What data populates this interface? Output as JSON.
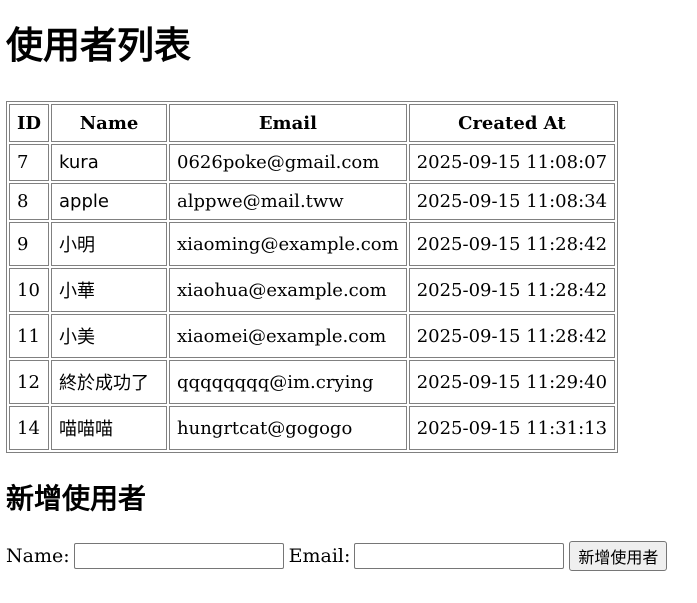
{
  "page_title": "使用者列表",
  "table": {
    "headers": [
      "ID",
      "Name",
      "Email",
      "Created At"
    ],
    "rows": [
      {
        "id": "7",
        "name": "kura",
        "email": "0626poke@gmail.com",
        "created_at": "2025-09-15 11:08:07"
      },
      {
        "id": "8",
        "name": "apple",
        "email": "alppwe@mail.tww",
        "created_at": "2025-09-15 11:08:34"
      },
      {
        "id": "9",
        "name": "小明",
        "email": "xiaoming@example.com",
        "created_at": "2025-09-15 11:28:42"
      },
      {
        "id": "10",
        "name": "小華",
        "email": "xiaohua@example.com",
        "created_at": "2025-09-15 11:28:42"
      },
      {
        "id": "11",
        "name": "小美",
        "email": "xiaomei@example.com",
        "created_at": "2025-09-15 11:28:42"
      },
      {
        "id": "12",
        "name": "終於成功了",
        "email": "qqqqqqqq@im.crying",
        "created_at": "2025-09-15 11:29:40"
      },
      {
        "id": "14",
        "name": "喵喵喵",
        "email": "hungrtcat@gogogo",
        "created_at": "2025-09-15 11:31:13"
      }
    ]
  },
  "form": {
    "heading": "新增使用者",
    "name_label": "Name:",
    "name_value": "",
    "email_label": "Email:",
    "email_value": "",
    "submit_label": "新增使用者"
  }
}
